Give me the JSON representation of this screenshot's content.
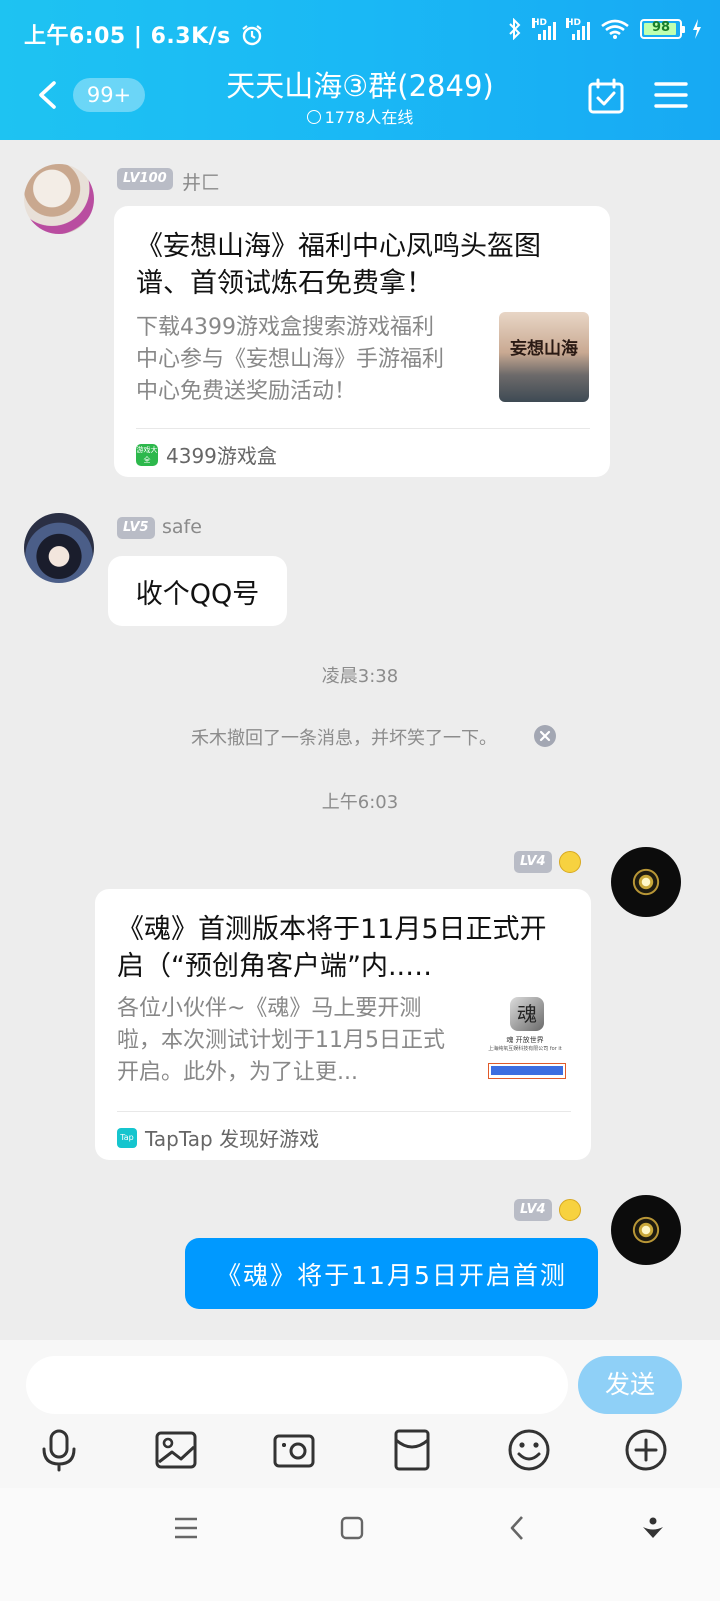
{
  "status_bar": {
    "time": "上午6:05",
    "speed": "6.3K/s",
    "hd1": "HD",
    "hd2": "HD",
    "battery": "98"
  },
  "header": {
    "unread_badge": "99+",
    "title": "天天山海③群(2849)",
    "online": "1778人在线"
  },
  "messages": [
    {
      "type": "card",
      "level": "LV100",
      "name": "井匚",
      "title": "《妄想山海》福利中心凤鸣头盔图谱、首领试炼石免费拿！",
      "title_lines": [
        "《妄想山海》福利中心凤鸣头盔图",
        "谱、首领试炼石免费拿！"
      ],
      "desc_lines": [
        "下载4399游戏盒搜索游戏福利",
        "中心参与《妄想山海》手游福利",
        "中心免费送奖励活动！"
      ],
      "thumb_text": "妄想山海",
      "source": "4399游戏盒",
      "source_icon_text": "游戏大全"
    },
    {
      "type": "text",
      "level": "LV5",
      "name": "safe",
      "text": "收个QQ号"
    },
    {
      "type": "time",
      "text": "凌晨3:38"
    },
    {
      "type": "system",
      "text": "禾木撤回了一条消息，并坏笑了一下。"
    },
    {
      "type": "time",
      "text": "上午6:03"
    },
    {
      "type": "card",
      "self": true,
      "level": "LV4",
      "title_lines": [
        "《魂》首测版本将于11月5日正式开",
        "启（“预创角客户端”内..…"
      ],
      "desc_lines": [
        "各位小伙伴~《魂》马上要开测",
        "啦，本次测试计划于11月5日正式",
        "开启。此外，为了让更..."
      ],
      "thumb_text": "魂",
      "thumb_caption": "魂 开放世界",
      "thumb_company": "上海纯氧互娱科技有限公司 for it",
      "source": "TapTap 发现好游戏",
      "source_icon_text": "Tap"
    },
    {
      "type": "text",
      "self": true,
      "level": "LV4",
      "text": "《魂》将于11月5日开启首测"
    }
  ],
  "input": {
    "placeholder": "",
    "send_label": "发送"
  },
  "colors": {
    "header": "#1ab8f5",
    "self_bubble": "#0099ff",
    "send_disabled": "#8fd0f7"
  }
}
